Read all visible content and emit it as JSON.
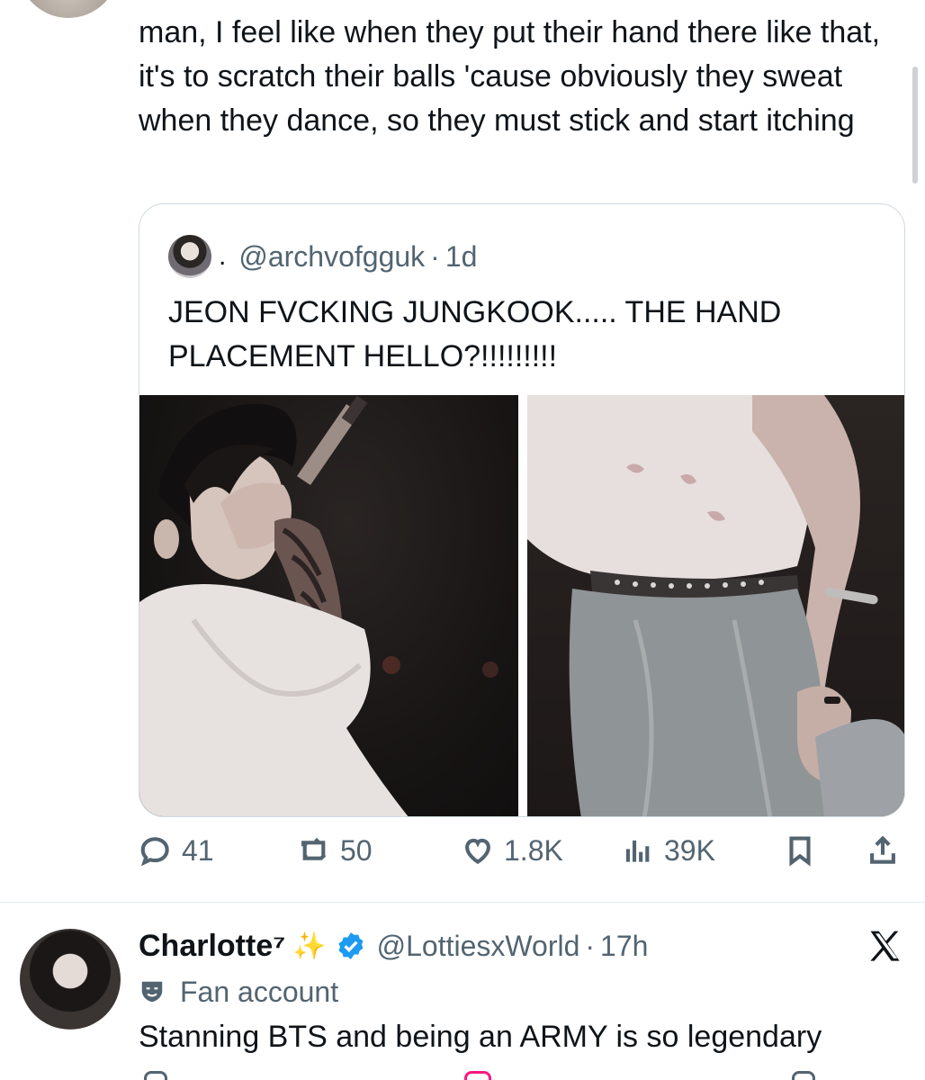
{
  "tweet": {
    "text": "man, I feel like when they put their hand there like that, it's to scratch their balls 'cause obviously they sweat when they dance, so they must stick and start itching"
  },
  "quote": {
    "dot": ".",
    "handle": "@archvofgguk",
    "separator": "·",
    "time": "1d",
    "text": "JEON FVCKING JUNGKOOK..... THE HAND PLACEMENT HELLO?!!!!!!!!!"
  },
  "actions": {
    "reply_count": "41",
    "retweet_count": "50",
    "like_count": "1.8K",
    "views_count": "39K"
  },
  "reply": {
    "name": "Charlotte⁷",
    "sparkle": "✨",
    "handle": "@LottiesxWorld",
    "separator": "·",
    "time": "17h",
    "label": "Fan account",
    "text": "Stanning BTS and being an ARMY is so legendary"
  },
  "colors": {
    "text": "#0f1419",
    "muted": "#536471",
    "border": "#cfd9de",
    "verified": "#1d9bf0"
  },
  "icons": {
    "reply": "comment-icon",
    "retweet": "retweet-icon",
    "like": "heart-icon",
    "views": "views-bar-icon",
    "bookmark": "bookmark-icon",
    "share": "share-icon",
    "platform": "x-logo-icon",
    "verified": "verified-badge-icon",
    "label": "theater-mask-icon"
  }
}
